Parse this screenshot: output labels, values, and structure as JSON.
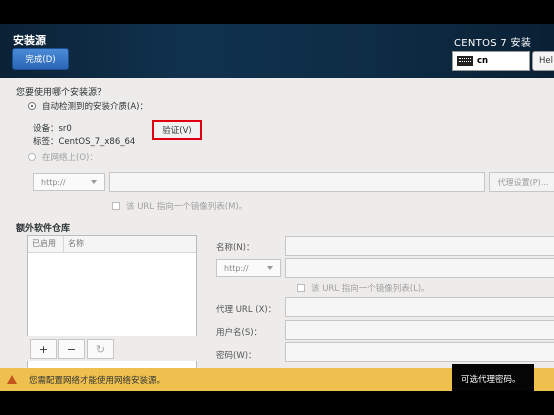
{
  "header": {
    "title": "安装源",
    "done_label": "完成(D)",
    "product": "CENTOS 7 安装",
    "keyboard_layout": "cn",
    "help_label": "Hel"
  },
  "source": {
    "question": "您要使用哪个安装源？",
    "auto_detect_label": "自动检测到的安装介质(A)：",
    "device_label": "设备：sr0",
    "volume_label": "标签：CentOS_7_x86_64",
    "verify_label": "验证(V)",
    "network_label": "在网络上(O)：",
    "protocol": "http://",
    "url_value": "",
    "proxy_button": "代理设置(P)...",
    "mirror_checkbox": "该 URL 指向一个镜像列表(M)。"
  },
  "repos": {
    "section_title": "额外软件仓库",
    "columns": [
      "已启用",
      "名称"
    ],
    "add_label": "+",
    "remove_label": "−",
    "refresh_label": "↻",
    "name_label": "名称(N)：",
    "protocol": "http://",
    "mirror_checkbox": "该 URL 指向一个镜像列表(L)。",
    "proxy_url_label": "代理 URL (X)：",
    "username_label": "用户名(S)：",
    "password_label": "密码(W)："
  },
  "status": {
    "warning": "您需配置网络才能使用网络安装源。",
    "tooltip": "可选代理密码。"
  },
  "colors": {
    "header_bg": "#10324f",
    "done_button": "#3a78c9",
    "verify_highlight": "#e0000f",
    "warning_bar": "#f0c04e"
  }
}
